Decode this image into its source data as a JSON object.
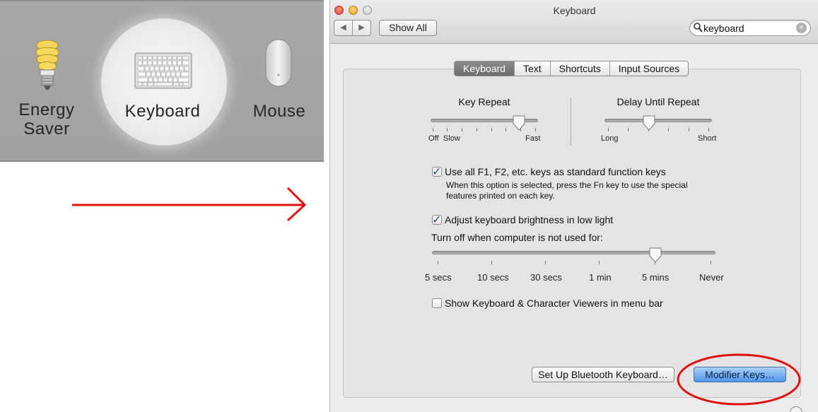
{
  "left_panel": {
    "energy_saver_label_line1": "Energy",
    "energy_saver_label_line2": "Saver",
    "keyboard_label": "Keyboard",
    "mouse_label": "Mouse"
  },
  "annotation": {
    "arrow_color": "#e01010",
    "ellipse_color": "#e01010"
  },
  "window": {
    "title": "Keyboard",
    "nav_back": "◀",
    "nav_forward": "▶",
    "show_all": "Show All",
    "search_value": "keyboard",
    "clear_glyph": "×"
  },
  "tabs": [
    {
      "label": "Keyboard",
      "active": true
    },
    {
      "label": "Text",
      "active": false
    },
    {
      "label": "Shortcuts",
      "active": false
    },
    {
      "label": "Input Sources",
      "active": false
    }
  ],
  "key_repeat": {
    "title": "Key Repeat",
    "min_label": "Off",
    "slow_label": "Slow",
    "max_label": "Fast",
    "value_fraction": 0.82
  },
  "delay_until_repeat": {
    "title": "Delay Until Repeat",
    "min_label": "Long",
    "max_label": "Short",
    "value_fraction": 0.4
  },
  "function_keys": {
    "label": "Use all F1, F2, etc. keys as standard function keys",
    "checked": true,
    "desc_line1": "When this option is selected, press the Fn key to use the special",
    "desc_line2": "features printed on each key."
  },
  "brightness": {
    "label": "Adjust keyboard brightness in low light",
    "checked": true
  },
  "turn_off": {
    "title": "Turn off when computer is not used for:",
    "ticks": [
      "5 secs",
      "10 secs",
      "30 secs",
      "1 min",
      "5 mins",
      "Never"
    ],
    "value_label": "5 mins"
  },
  "viewers": {
    "label": "Show Keyboard & Character Viewers in menu bar",
    "checked": false
  },
  "buttons": {
    "bluetooth": "Set Up Bluetooth Keyboard…",
    "modifier": "Modifier Keys…"
  }
}
